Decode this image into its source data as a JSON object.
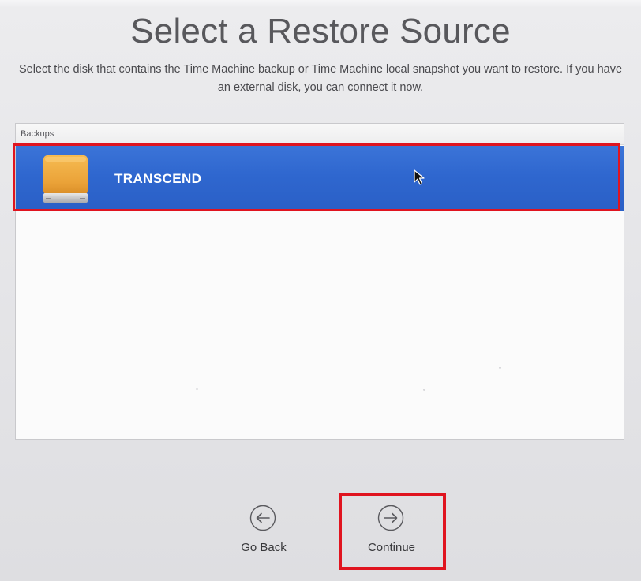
{
  "dialog": {
    "title": "Select a Restore Source",
    "description": "Select the disk that contains the Time Machine backup or Time Machine local snapshot you want to restore. If you have an external disk, you can connect it now."
  },
  "backups_list": {
    "header": "Backups",
    "items": [
      {
        "label": "TRANSCEND",
        "icon": "external-disk-icon",
        "selected": true
      }
    ]
  },
  "navigation": {
    "go_back_label": "Go Back",
    "go_back_icon": "arrow-left-circle-icon",
    "continue_label": "Continue",
    "continue_icon": "arrow-right-circle-icon"
  },
  "colors": {
    "selection_blue": "#2f67cf",
    "annotation_red": "#e0141f",
    "disk_orange": "#f0a83a"
  }
}
